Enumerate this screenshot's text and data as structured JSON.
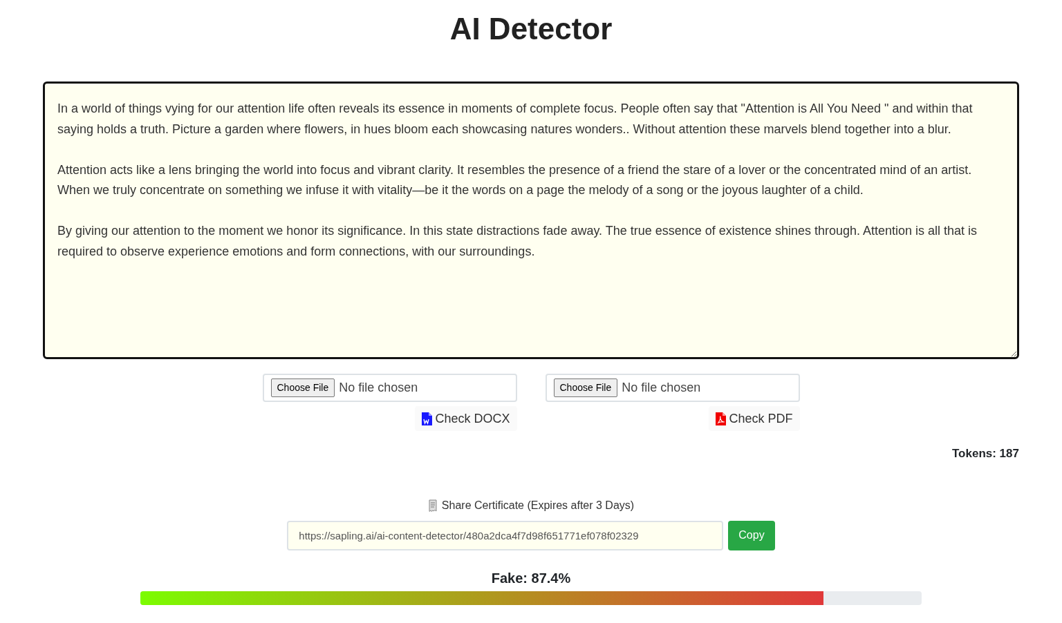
{
  "title": "AI Detector",
  "text_input": {
    "paragraphs": [
      "In a world of things vying for our attention life often reveals its essence in moments of complete focus. People often say that \"Attention is All You Need \" and within that saying holds a truth. Picture a garden where flowers, in hues bloom each showcasing natures wonders.. Without attention these marvels blend together into a blur.",
      "Attention acts like a lens bringing the world into focus and vibrant clarity. It resembles the presence of a friend the stare of a lover or the concentrated mind of an artist. When we truly concentrate on something we infuse it with vitality—be it the words on a page the melody of a song or the joyous laughter of a child.",
      "By giving our attention to the moment we honor its significance. In this state distractions fade away. The true essence of existence shines through. Attention is all that is required to observe experience emotions and form connections, with our surroundings."
    ]
  },
  "uploads": [
    {
      "button": "Choose File",
      "status": "No file chosen",
      "action": "Check DOCX",
      "kind": "docx"
    },
    {
      "button": "Choose File",
      "status": "No file chosen",
      "action": "Check PDF",
      "kind": "pdf"
    }
  ],
  "tokens": "Tokens: 187",
  "share": {
    "label": "Share Certificate (Expires after 3 Days)",
    "url": "https://sapling.ai/ai-content-detector/480a2dca4f7d98f651771ef078f02329",
    "button": "Copy"
  },
  "result": {
    "label": "Fake: 87.4%",
    "level": 0.874
  }
}
